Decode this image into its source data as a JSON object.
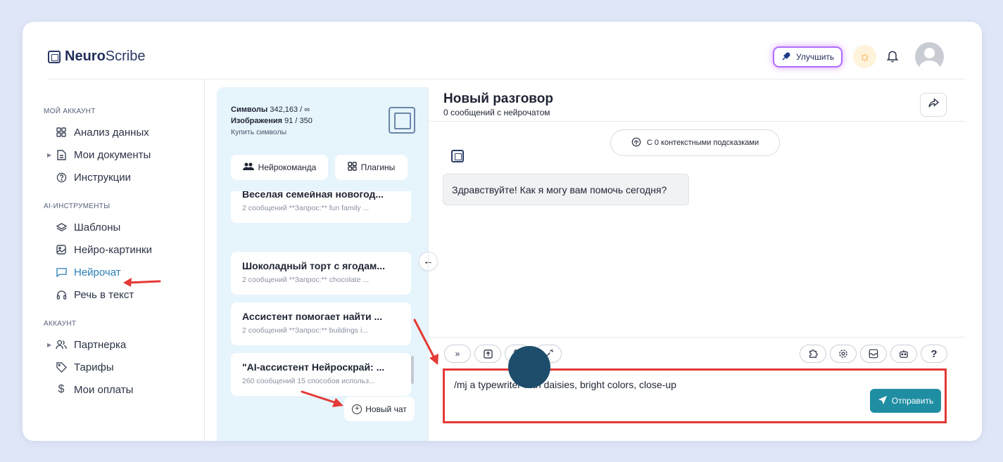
{
  "header": {
    "brand_bold": "Neuro",
    "brand_regular": "Scribe",
    "upgrade_label": "Улучшить"
  },
  "sidebar": {
    "section_account": "МОЙ АККАУНТ",
    "account_items": [
      {
        "label": "Анализ данных",
        "icon": "grid-icon"
      },
      {
        "label": "Мои документы",
        "icon": "document-icon"
      },
      {
        "label": "Инструкции",
        "icon": "help-circle-icon"
      }
    ],
    "section_ai": "AI-ИНСТРУМЕНТЫ",
    "ai_items": [
      {
        "label": "Шаблоны",
        "icon": "layers-icon"
      },
      {
        "label": "Нейро-картинки",
        "icon": "image-icon"
      },
      {
        "label": "Нейрочат",
        "icon": "chat-icon",
        "active": true
      },
      {
        "label": "Речь в текст",
        "icon": "headphones-icon"
      }
    ],
    "section_profile": "АККАУНТ",
    "profile_items": [
      {
        "label": "Партнерка",
        "icon": "users-icon"
      },
      {
        "label": "Тарифы",
        "icon": "tag-icon"
      },
      {
        "label": "Мои оплаты",
        "icon": "dollar-icon"
      }
    ]
  },
  "stats": {
    "symbols_label": "Символы",
    "symbols_value": "342,163 / ∞",
    "images_label": "Изображения",
    "images_value": "91 / 350",
    "buy_link": "Купить символы"
  },
  "panel": {
    "team_button": "Нейрокоманда",
    "plugins_button": "Плагины",
    "new_chat_button": "Новый чат"
  },
  "chats": [
    {
      "title": "Веселая семейная новогод...",
      "meta": "2 сообщений    **Запрос:** fun family ..."
    },
    {
      "title": "Шоколадный торт с ягодам...",
      "meta": "2 сообщений    **Запрос:** chocolate ..."
    },
    {
      "title": "Ассистент помогает найти ...",
      "meta": "2 сообщений    **Запрос:** buildings i..."
    },
    {
      "title": "\"AI-ассистент Нейроскрай: ...",
      "meta": "260 сообщений 15 способов использ..."
    }
  ],
  "conversation": {
    "title": "Новый разговор",
    "subtitle": "0 сообщений с нейрочатом",
    "context_hint": "С 0 контекстными подсказками",
    "greeting": "Здравствуйте! Как я могу вам помочь сегодня?"
  },
  "composer": {
    "input_value": "/mj a typewriter with daisies, bright colors, close-up",
    "send_label": "Отправить",
    "help_label": "?"
  },
  "colors": {
    "accent": "#1f8ea3",
    "active_nav": "#2a7fb8",
    "annotation_red": "#e53935",
    "panel_bg": "#e6f4fc"
  }
}
